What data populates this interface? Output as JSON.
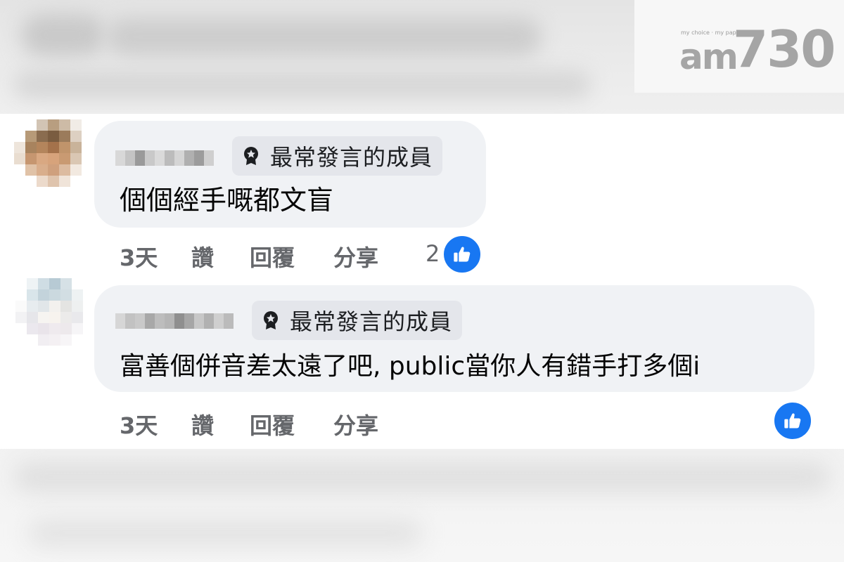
{
  "watermark": {
    "brand": "am730",
    "brand_prefix": "am",
    "brand_number": "730",
    "tagline": "my choice · my paper"
  },
  "colors": {
    "accent": "#1877f2",
    "bubble_bg": "#f0f2f5",
    "badge_bg": "#e4e6eb",
    "meta_text": "#65676b"
  },
  "comments": [
    {
      "badge_icon": "award-ribbon-icon",
      "badge_label": "最常發言的成員",
      "text": "個個經手嘅都文盲",
      "time": "3天",
      "like_label": "讚",
      "reply_label": "回覆",
      "share_label": "分享",
      "reaction_count": "2",
      "reaction_icon": "thumbs-up-icon"
    },
    {
      "badge_icon": "award-ribbon-icon",
      "badge_label": "最常發言的成員",
      "text": "富善個併音差太遠了吧, public當你人有錯手打多個i",
      "time": "3天",
      "like_label": "讚",
      "reply_label": "回覆",
      "share_label": "分享",
      "reaction_icon": "thumbs-up-icon"
    }
  ]
}
